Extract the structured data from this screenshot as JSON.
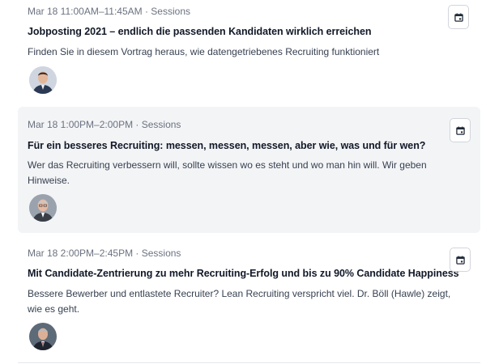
{
  "sessions": [
    {
      "meta": "Mar 18 11:00AM–11:45AM · Sessions",
      "title": "Jobposting 2021 – endlich die passenden Kandidaten wirklich erreichen",
      "description": "Finden Sie in diesem Vortrag heraus, wie datengetriebenes Recruiting funktioniert",
      "avatar_icon": "speaker-avatar",
      "calendar_icon": "calendar-add-icon"
    },
    {
      "meta": "Mar 18 1:00PM–2:00PM · Sessions",
      "title": "Für ein besseres Recruiting: messen, messen, messen, aber wie, was und für wen?",
      "description": "Wer das Recruiting verbessern will, sollte wissen wo es steht und wo man hin will. Wir geben Hinweise.",
      "avatar_icon": "speaker-avatar",
      "calendar_icon": "calendar-add-icon"
    },
    {
      "meta": "Mar 18 2:00PM–2:45PM · Sessions",
      "title": "Mit Candidate-Zentrierung zu mehr Recruiting-Erfolg und bis zu 90% Candidate Happiness",
      "description": "Bessere Bewerber und entlastete Recruiter? Lean Recruiting verspricht viel. Dr. Böll (Hawle) zeigt, wie es geht.",
      "avatar_icon": "speaker-avatar",
      "calendar_icon": "calendar-add-icon"
    }
  ],
  "colors": {
    "highlight_bg": "#f3f4f6",
    "meta_text": "#6b7280",
    "title_text": "#111827",
    "border": "#d1d5db"
  }
}
